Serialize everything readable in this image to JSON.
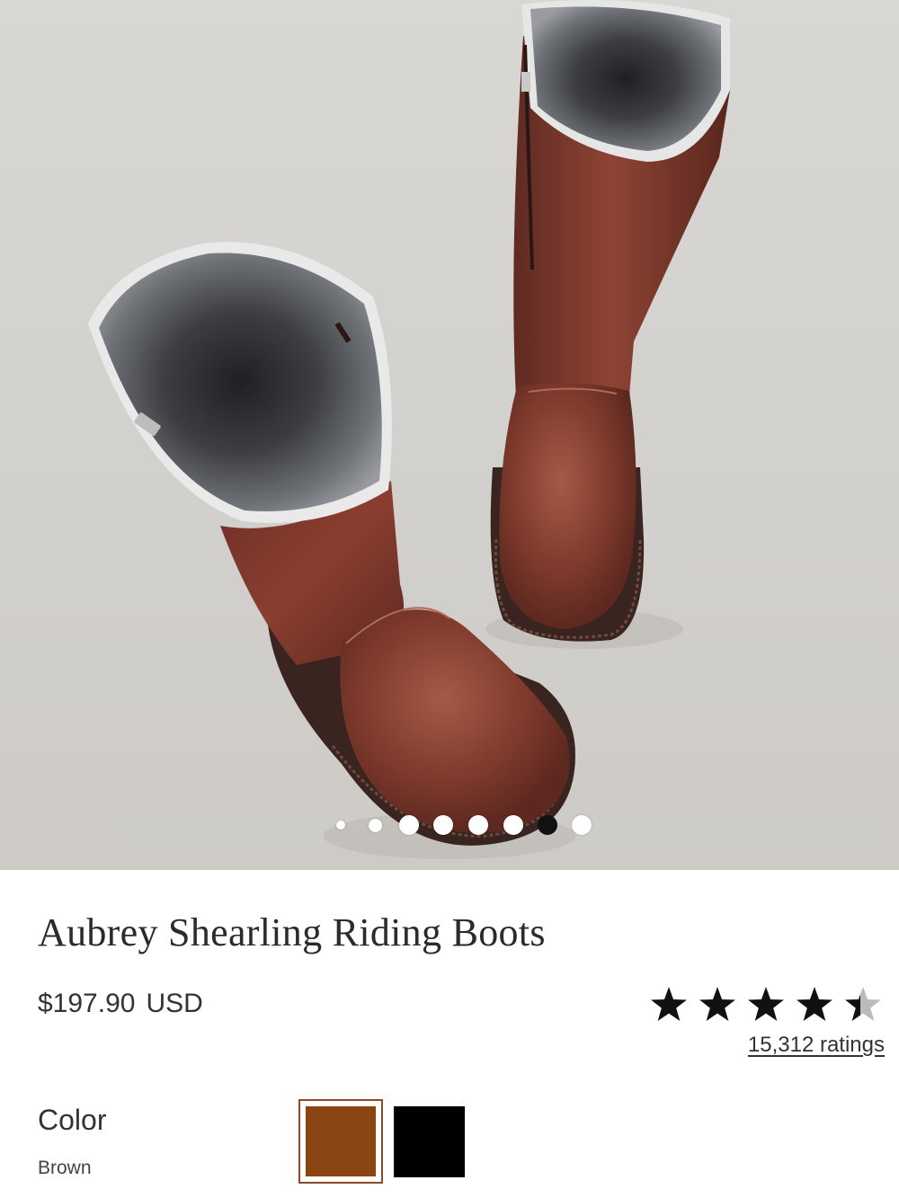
{
  "product": {
    "title": "Aubrey Shearling Riding Boots",
    "price": "$197.90",
    "currency": "USD"
  },
  "gallery": {
    "image_alt": "Brown shearling-lined leather riding boots",
    "slide_count": 8,
    "active_slide": 7
  },
  "rating": {
    "value": 4.5,
    "max": 5,
    "count_label": "15,312 ratings"
  },
  "color": {
    "label": "Color",
    "selected": "Brown",
    "options": [
      {
        "name": "Brown",
        "hex": "#8B4513"
      },
      {
        "name": "Black",
        "hex": "#000000"
      }
    ]
  },
  "colors": {
    "star": "#111111",
    "star_empty": "#bbbbbb",
    "boot_leather": "#7a3427",
    "shearling": "#6f7276"
  }
}
